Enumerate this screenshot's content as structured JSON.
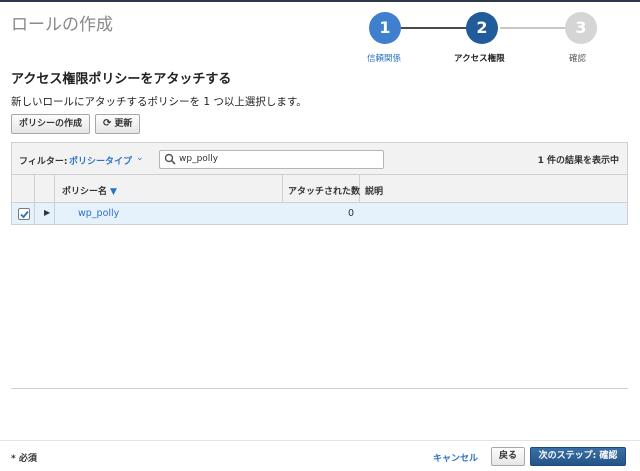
{
  "page": {
    "title": "ロールの作成"
  },
  "steps": [
    {
      "number": "1",
      "label": "信頼関係"
    },
    {
      "number": "2",
      "label": "アクセス権限"
    },
    {
      "number": "3",
      "label": "確認"
    }
  ],
  "section": {
    "title": "アクセス権限ポリシーをアタッチする",
    "description": "新しいロールにアタッチするポリシーを 1 つ以上選択します。"
  },
  "toolbar": {
    "create_policy_label": "ポリシーの作成",
    "refresh_label": "更新"
  },
  "filter": {
    "label": "フィルター:",
    "value": "ポリシータイプ",
    "search_value": "wp_polly",
    "result_count": "1 件の結果を表示中"
  },
  "table": {
    "columns": [
      "ポリシー名",
      "アタッチされた数",
      "説明"
    ],
    "rows": [
      {
        "selected": true,
        "name": "wp_polly",
        "attached": "0",
        "description": ""
      }
    ]
  },
  "footer": {
    "required_label": "* 必須",
    "cancel_label": "キャンセル",
    "back_label": "戻る",
    "next_label": "次のステップ: 確認"
  },
  "colors": {
    "accent": "#2b73c4",
    "step_active": "#1f5c99",
    "step_done": "#3f7fce",
    "step_pending": "#d5d5d5",
    "row_selected": "#e5f1fb",
    "primary_button": "#235487"
  }
}
